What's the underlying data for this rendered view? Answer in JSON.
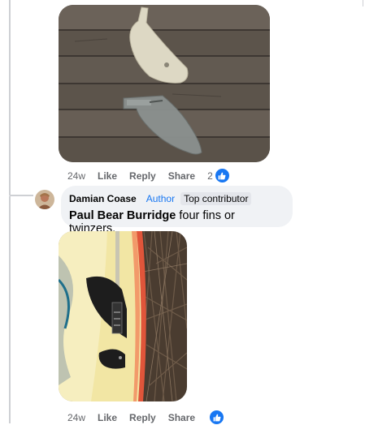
{
  "comment1": {
    "image_alt": "Two surfboard fins on a wooden deck",
    "actions": {
      "time": "24w",
      "like": "Like",
      "reply": "Reply",
      "share": "Share",
      "reaction_count": "2"
    }
  },
  "reply": {
    "author_name": "Damian Coase",
    "author_tag": "Author",
    "badge": "Top contributor",
    "mention": "Paul Bear Burridge",
    "text": " four fins or twinzers.",
    "image_alt": "Surfboard tail with fins against brush",
    "actions": {
      "time": "24w",
      "like": "Like",
      "reply": "Reply",
      "share": "Share"
    }
  },
  "colors": {
    "accent": "#1877f2",
    "bubble": "#f0f2f5",
    "muted": "#65676b"
  },
  "icons": {
    "reaction": "like-thumb-icon"
  }
}
